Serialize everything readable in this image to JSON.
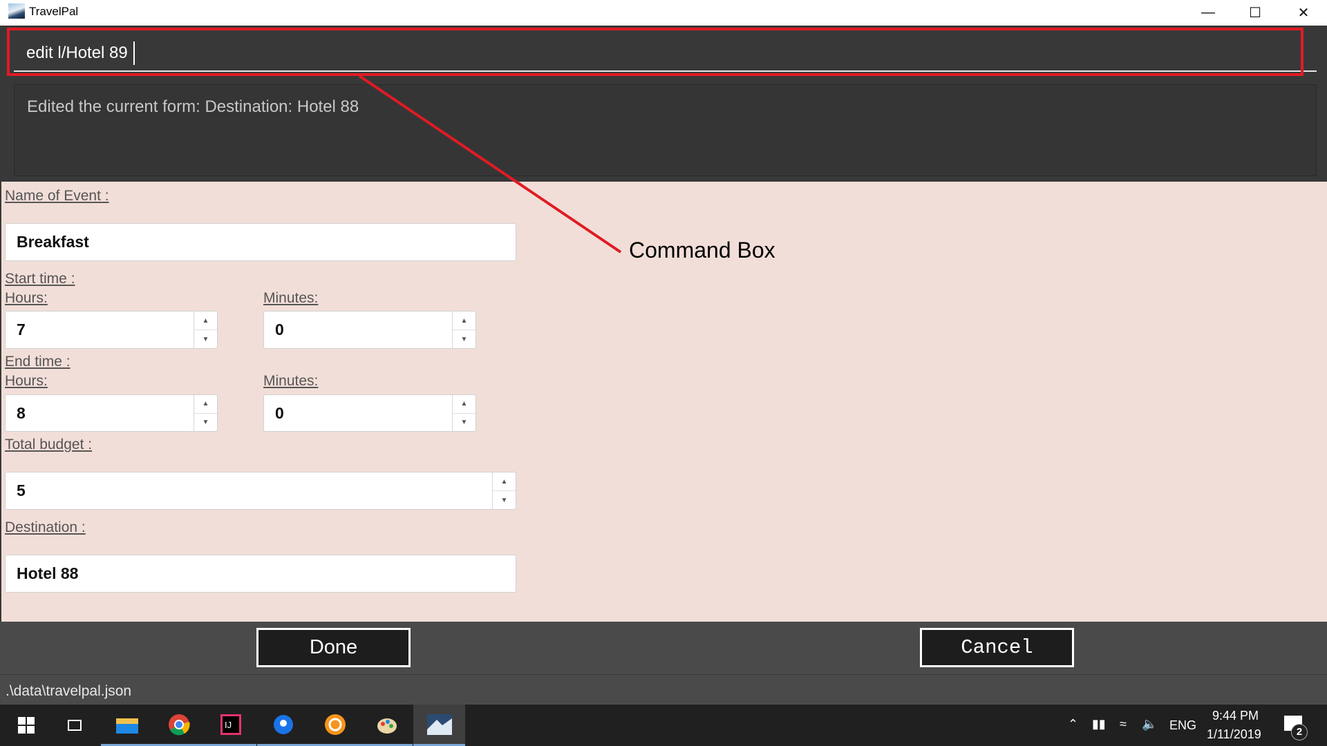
{
  "window": {
    "title": "TravelPal",
    "controls": [
      "minimize",
      "maximize",
      "close"
    ]
  },
  "command_box": {
    "value": "edit l/Hotel 89"
  },
  "result_display": {
    "text": "Edited the current form: Destination: Hotel 88"
  },
  "form": {
    "name_label": "Name of Event :",
    "name_value": "Breakfast",
    "start_label": "Start time :",
    "start_hours_label": "Hours:",
    "start_hours": "7",
    "start_minutes_label": "Minutes:",
    "start_minutes": "0",
    "end_label": "End time :",
    "end_hours_label": "Hours:",
    "end_hours": "8",
    "end_minutes_label": "Minutes:",
    "end_minutes": "0",
    "budget_label": "Total budget :",
    "budget_value": "5",
    "destination_label": "Destination :",
    "destination_value": "Hotel 88"
  },
  "buttons": {
    "done": "Done",
    "cancel": "Cancel"
  },
  "status_bar": {
    "path": ".\\data\\travelpal.json"
  },
  "annotation": {
    "label": "Command Box",
    "color": "#e01b24"
  },
  "taskbar": {
    "apps": [
      "windows-start",
      "task-view",
      "file-explorer",
      "chrome",
      "intellij",
      "maps",
      "paint-app",
      "paint-3d",
      "travelpal"
    ],
    "language": "ENG",
    "time": "9:44 PM",
    "date": "1/11/2019",
    "notifications": "2"
  }
}
